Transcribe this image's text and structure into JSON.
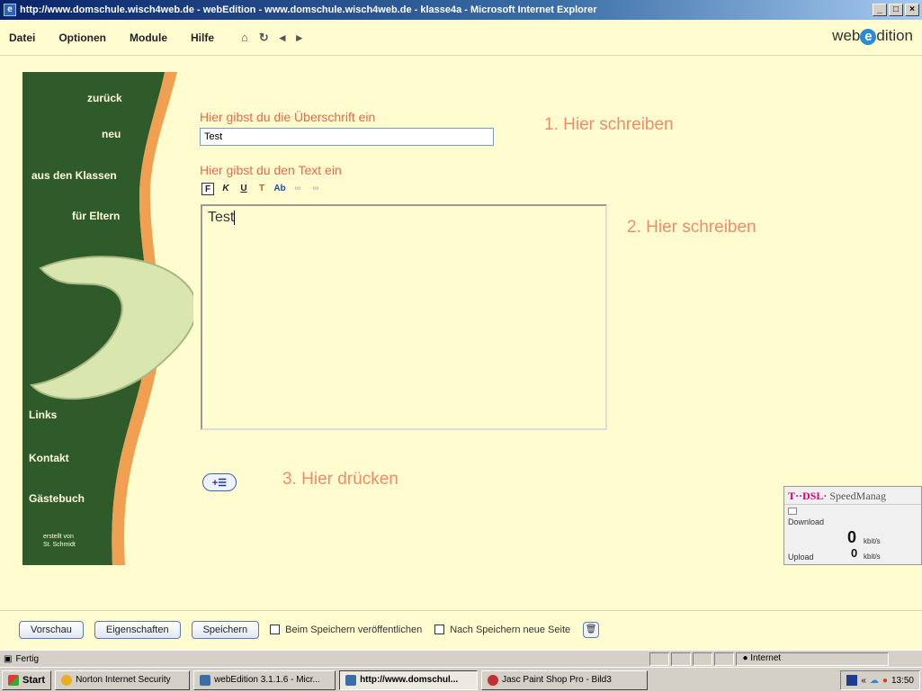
{
  "window": {
    "title": "http://www.domschule.wisch4web.de - webEdition - www.domschule.wisch4web.de - klasse4a - Microsoft Internet Explorer",
    "controls": [
      "_",
      "□",
      "×"
    ]
  },
  "menu": {
    "items": [
      "Datei",
      "Optionen",
      "Module",
      "Hilfe"
    ],
    "nav_icons": [
      "home-icon",
      "reload-icon",
      "back-icon",
      "forward-icon"
    ],
    "brand_prefix": "web",
    "brand_mark": "e",
    "brand_suffix": "dition"
  },
  "sidebar": {
    "links": {
      "zurueck": "zurück",
      "neu": "neu",
      "klassen": "aus den Klassen",
      "eltern": "für Eltern",
      "links": "Links",
      "kontakt": "Kontakt",
      "gaestebuch": "Gästebuch"
    },
    "credit_line1": "erstellt von",
    "credit_line2": "St. Schmidt",
    "colors": {
      "green": "#2f5a2a",
      "orange": "#f0a050",
      "logo": "#d9e6b0"
    }
  },
  "form": {
    "heading_label": "Hier gibst du die Überschrift ein",
    "heading_value": "Test",
    "text_label": "Hier gibst du den Text ein",
    "text_value": "Test",
    "toolbar": [
      "F",
      "K",
      "U",
      "T",
      "Ab",
      "∞",
      "∞"
    ],
    "step1": "1. Hier schreiben",
    "step2": "2. Hier schreiben",
    "step3": "3. Hier drücken"
  },
  "dsl_widget": {
    "title_brand": "T··DSL·",
    "title_app": "SpeedManag",
    "download_label": "Download",
    "upload_label": "Upload",
    "download_value": "0",
    "upload_value": "0",
    "unit": "kbit/s"
  },
  "bottom": {
    "preview": "Vorschau",
    "properties": "Eigenschaften",
    "save": "Speichern",
    "publish_on_save": "Beim Speichern veröffentlichen",
    "new_page_after_save": "Nach Speichern neue Seite"
  },
  "status": {
    "text": "Fertig",
    "zone": "Internet"
  },
  "taskbar": {
    "start": "Start",
    "tasks": [
      "Norton Internet Security",
      "webEdition 3.1.1.6 - Micr...",
      "http://www.domschul...",
      "Jasc Paint Shop Pro - Bild3"
    ],
    "clock": "13:50"
  }
}
